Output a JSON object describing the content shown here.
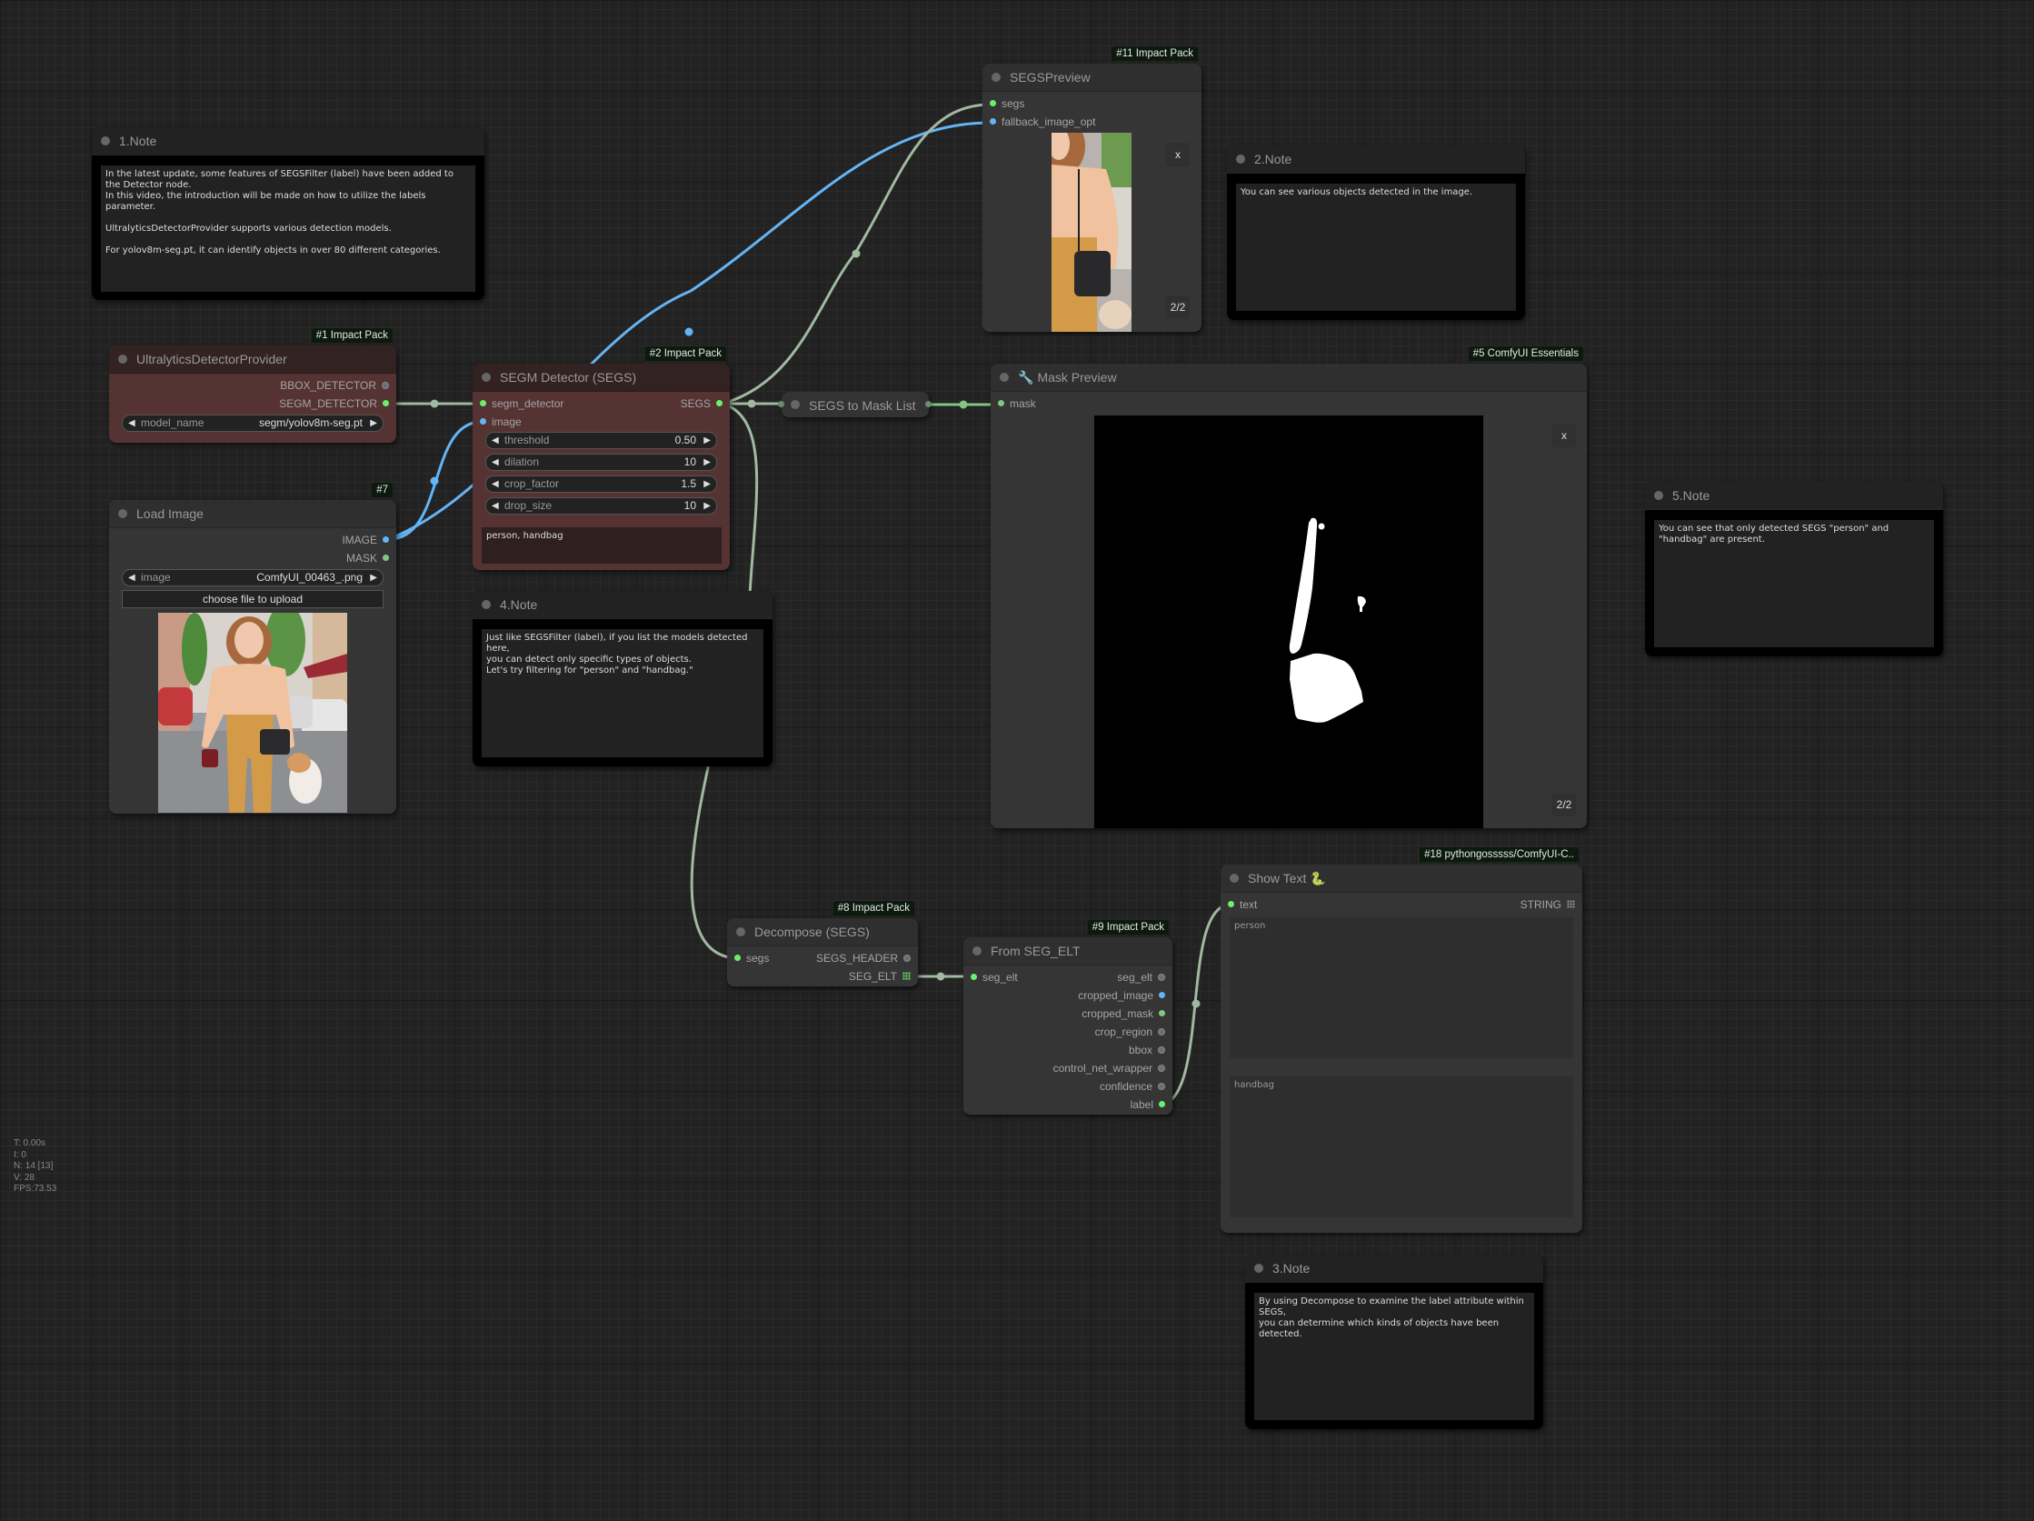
{
  "canvas": {
    "background": "#222222",
    "link_colors": {
      "image": "#64b5f6",
      "segs": "#a1b8a1",
      "mask": "#81c784",
      "segm_detector": "#a1b8a1",
      "string": "#a1b8a1"
    }
  },
  "stats": [
    "T: 0.00s",
    "I: 0",
    "N: 14 [13]",
    "V: 28",
    "FPS:73.53"
  ],
  "nodes": {
    "note1": {
      "title": "1.Note",
      "text": "In the latest update, some features of SEGSFilter (label) have been added to the Detector node.\nIn this video, the introduction will be made on how to utilize the labels parameter.\n\nUltralyticsDetectorProvider supports various detection models.\n\nFor yolov8m-seg.pt, it can identify objects in over 80 different categories."
    },
    "detector_provider": {
      "badge": "#1 Impact Pack",
      "title": "UltralyticsDetectorProvider",
      "outputs": [
        "BBOX_DETECTOR",
        "SEGM_DETECTOR"
      ],
      "widget": {
        "label": "model_name",
        "value": "segm/yolov8m-seg.pt"
      }
    },
    "load_image": {
      "badge": "#7",
      "title": "Load Image",
      "outputs": [
        "IMAGE",
        "MASK"
      ],
      "widget": {
        "label": "image",
        "value": "ComfyUI_00463_.png"
      },
      "upload_label": "choose file to upload",
      "image_alt": "woman walking with a dog on a street"
    },
    "segm_detector": {
      "badge": "#2 Impact Pack",
      "title": "SEGM Detector (SEGS)",
      "inputs": [
        "segm_detector",
        "image"
      ],
      "outputs": [
        "SEGS"
      ],
      "widgets": [
        {
          "label": "threshold",
          "value": "0.50"
        },
        {
          "label": "dilation",
          "value": "10"
        },
        {
          "label": "crop_factor",
          "value": "1.5"
        },
        {
          "label": "drop_size",
          "value": "10"
        }
      ],
      "labels_text": "person, handbag"
    },
    "note4": {
      "title": "4.Note",
      "text": "Just like SEGSFilter (label), if you list the models detected here,\nyou can detect only specific types of objects.\nLet's try filtering for \"person\" and \"handbag.\""
    },
    "segs_to_mask": {
      "title": "SEGS to Mask List"
    },
    "segs_preview": {
      "badge": "#11 Impact Pack",
      "title": "SEGSPreview",
      "inputs": [
        "segs",
        "fallback_image_opt"
      ],
      "close_label": "x",
      "counter": "2/2"
    },
    "note2": {
      "title": "2.Note",
      "text": "You can see various objects detected in the image."
    },
    "mask_preview": {
      "badge": "#5 ComfyUI Essentials",
      "title_icon": "🔧",
      "title": "Mask Preview",
      "inputs": [
        "mask"
      ],
      "close_label": "x",
      "counter": "2/2"
    },
    "note5": {
      "title": "5.Note",
      "text": "You can see that only detected SEGS \"person\" and \"handbag\" are present."
    },
    "decompose": {
      "badge": "#8 Impact Pack",
      "title": "Decompose (SEGS)",
      "inputs": [
        "segs"
      ],
      "outputs": [
        "SEGS_HEADER",
        "SEG_ELT"
      ]
    },
    "from_seg_elt": {
      "badge": "#9 Impact Pack",
      "title": "From SEG_ELT",
      "inputs": [
        "seg_elt"
      ],
      "outputs": [
        "seg_elt",
        "cropped_image",
        "cropped_mask",
        "crop_region",
        "bbox",
        "control_net_wrapper",
        "confidence",
        "label"
      ]
    },
    "show_text": {
      "badge": "#18 pythongosssss/ComfyUI-C..",
      "title": "Show Text",
      "title_icon": "🐍",
      "inputs": [
        "text"
      ],
      "output": "STRING",
      "values": [
        "person",
        "handbag"
      ]
    },
    "note3": {
      "title": "3.Note",
      "text": "By using Decompose to examine the label attribute within SEGS,\nyou can determine which kinds of objects have been detected."
    }
  }
}
